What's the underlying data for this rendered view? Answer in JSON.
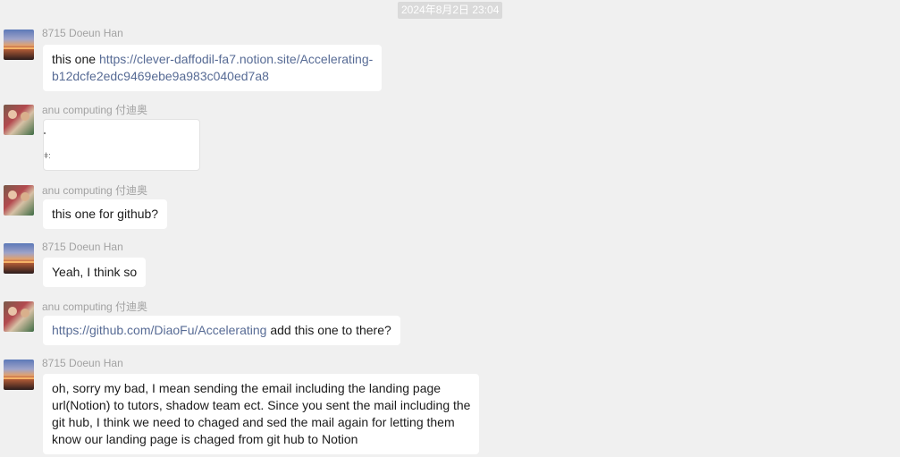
{
  "timestamp": "2024年8月2日 23:04",
  "messages": [
    {
      "sender": "8715 Doeun Han",
      "text_before": "this one ",
      "link_line1": "https://clever-daffodil-fa7.notion.site/Accelerating-",
      "link_line2": "b12dcfe2edc9469ebe9a983c040ed7a8"
    },
    {
      "sender": "anu computing 付迪奥",
      "file_mark": "⠂",
      "file_mark2": "ǂ:"
    },
    {
      "sender": "anu computing 付迪奥",
      "text": "this one for github?"
    },
    {
      "sender": "8715 Doeun Han",
      "text": "Yeah, I think so"
    },
    {
      "sender": "anu computing 付迪奥",
      "link": "https://github.com/DiaoFu/Accelerating",
      "text_after": " add this one to there?"
    },
    {
      "sender": "8715 Doeun Han",
      "lines": [
        "oh, sorry my bad, I mean sending the email including the landing page",
        "url(Notion) to tutors, shadow team ect. Since you sent the mail including the",
        "git hub, I think we need to chaged and sed the mail again for letting them",
        "know our landing page is chaged from git hub to Notion"
      ]
    }
  ],
  "colors": {
    "background": "#f0f0f0",
    "bubble": "#ffffff",
    "link": "#576b95",
    "sender": "#a2a2a2",
    "timestamp_bg": "#dadada"
  }
}
